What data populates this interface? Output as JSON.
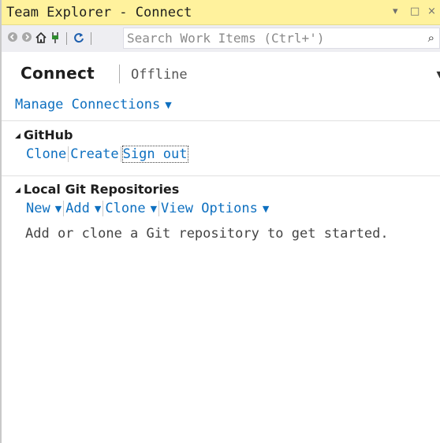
{
  "window": {
    "title": "Team Explorer - Connect",
    "controls": {
      "dropdown": "▾",
      "maximize": "□",
      "close": "×"
    }
  },
  "toolbar": {
    "icons": [
      "back-icon",
      "forward-icon",
      "home-icon",
      "plug-icon",
      "refresh-icon"
    ],
    "search": {
      "placeholder": "Search Work Items (Ctrl+')",
      "value": ""
    }
  },
  "header": {
    "title": "Connect",
    "status": "Offline"
  },
  "manage_connections": "Manage Connections",
  "sections": {
    "github": {
      "title": "GitHub",
      "links": [
        "Clone",
        "Create",
        "Sign out"
      ]
    },
    "local": {
      "title": "Local Git Repositories",
      "links": [
        "New",
        "Add",
        "Clone",
        "View Options"
      ],
      "hint": "Add or clone a Git repository to get started."
    }
  },
  "colors": {
    "titlebar": "#fff29d",
    "toolbar": "#eeeef2",
    "link": "#0e70c0"
  }
}
